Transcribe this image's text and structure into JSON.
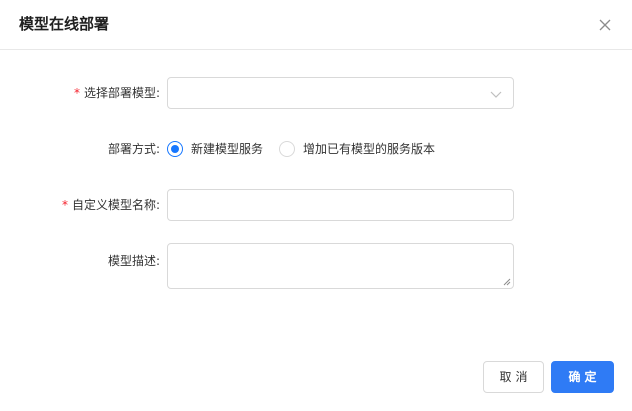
{
  "dialog": {
    "title": "模型在线部署",
    "close_icon": "close-icon"
  },
  "form": {
    "model_select": {
      "required_mark": "*",
      "label": "选择部署模型:",
      "value": "",
      "icon": "chevron-down-icon"
    },
    "deploy_mode": {
      "label": "部署方式:",
      "options": [
        {
          "label": "新建模型服务",
          "checked": true
        },
        {
          "label": "增加已有模型的服务版本",
          "checked": false
        }
      ]
    },
    "model_name": {
      "required_mark": "*",
      "label": "自定义模型名称:",
      "value": ""
    },
    "model_desc": {
      "label": "模型描述:",
      "value": ""
    }
  },
  "footer": {
    "cancel_label": "取消",
    "ok_label": "确定"
  },
  "colors": {
    "primary": "#2f7bf5",
    "required": "#f5222d",
    "border": "#d9d9d9"
  }
}
